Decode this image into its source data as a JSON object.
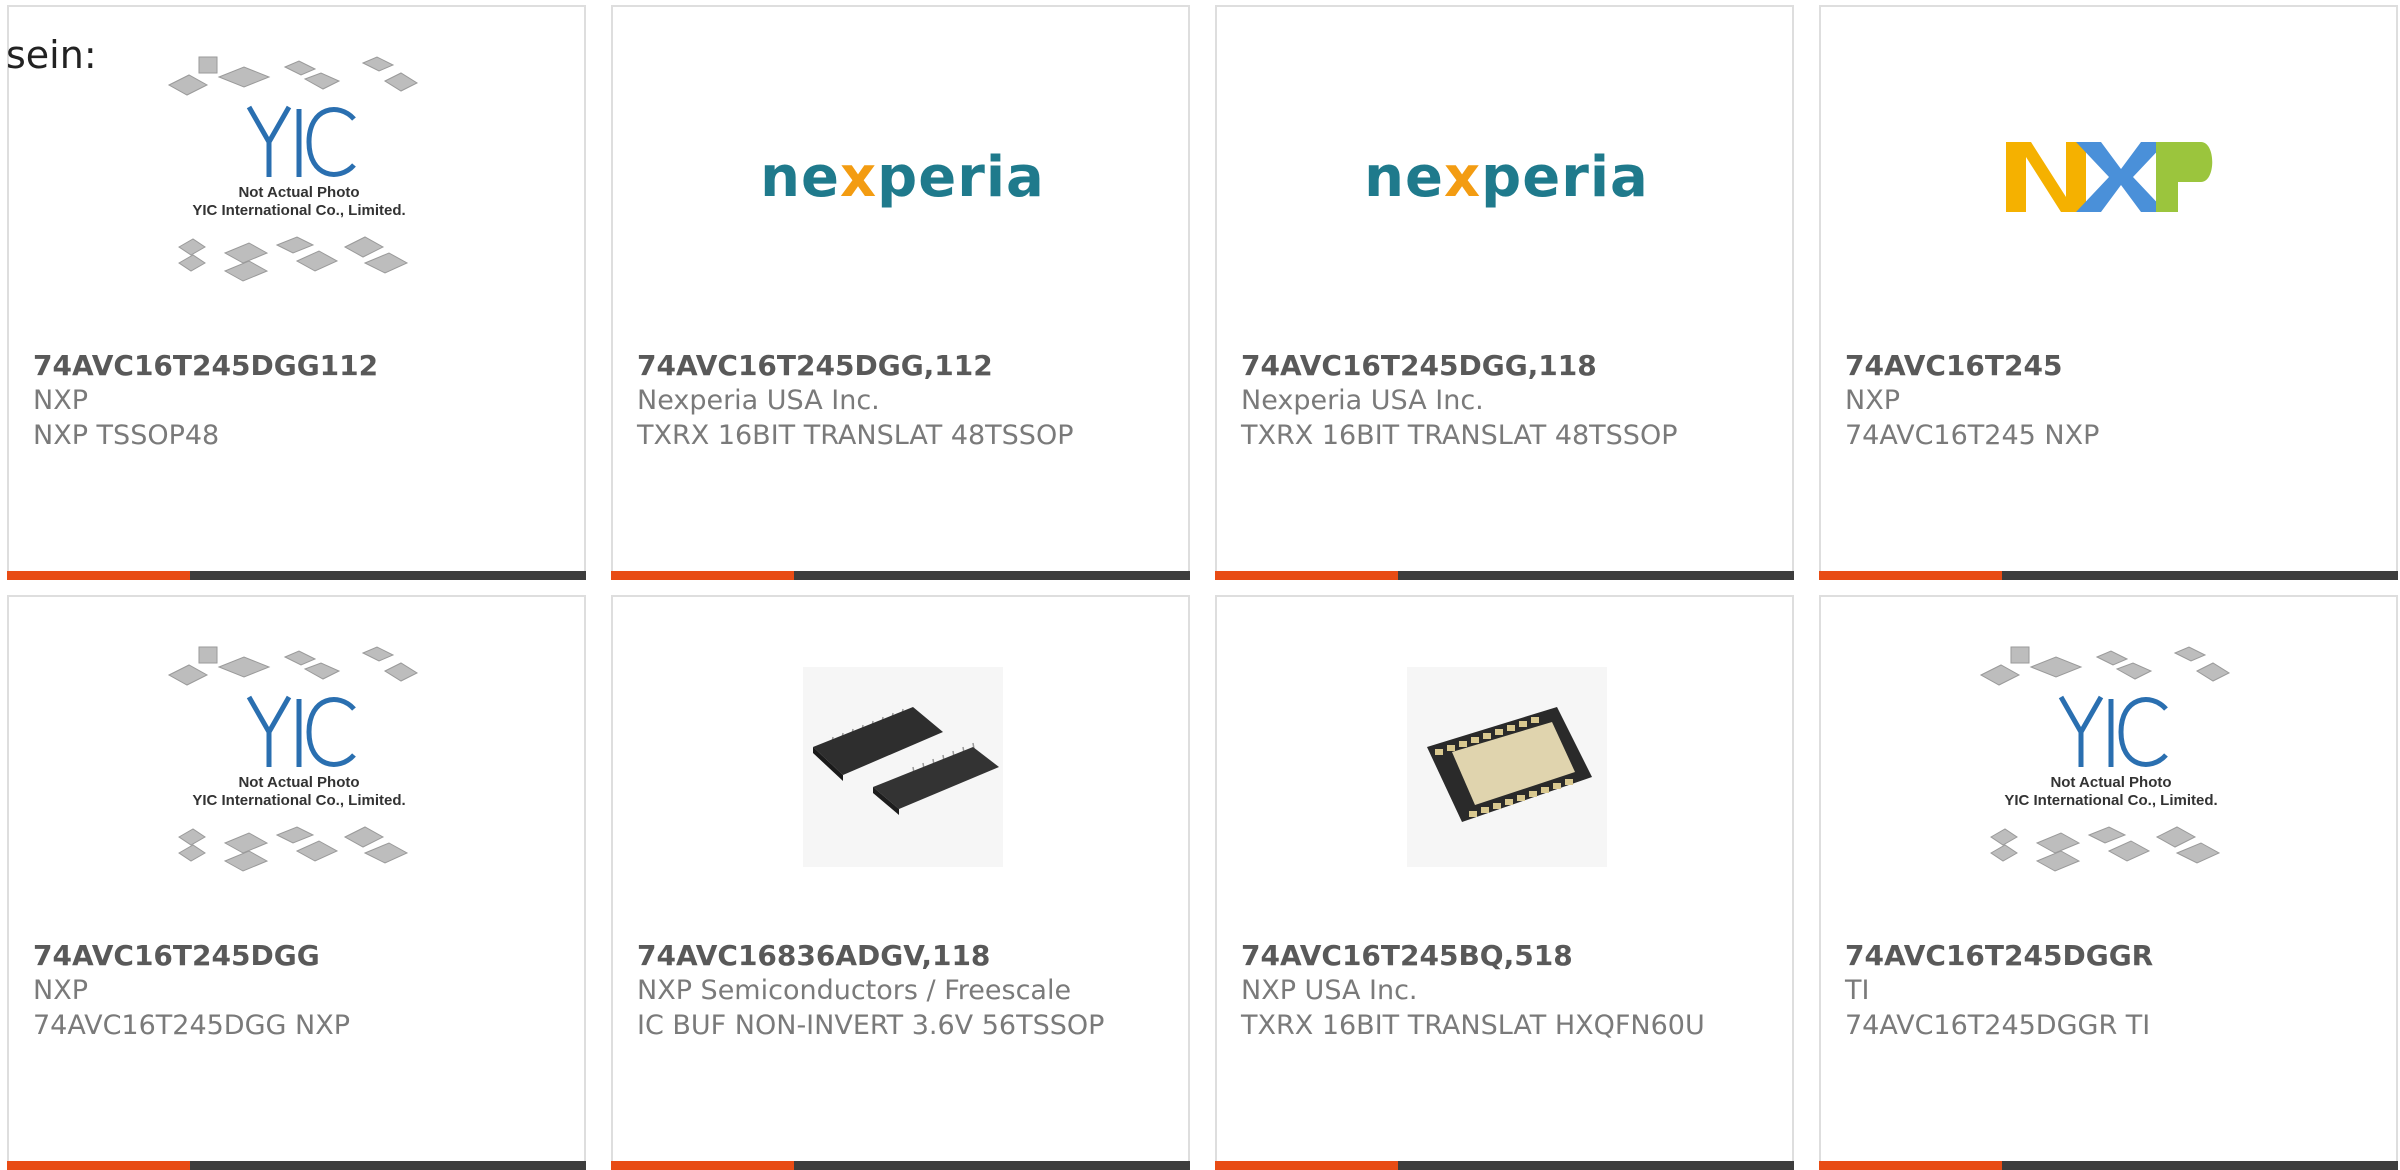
{
  "intro_text": "sein:",
  "brand_colors": {
    "accent": "#e84c15",
    "bar": "#3d3d3d",
    "nexperia_teal": "#1f7a8c",
    "nxp_yellow": "#f5b100",
    "nxp_blue": "#4a90d9",
    "nxp_green": "#9bc53d"
  },
  "products": [
    {
      "name": "74AVC16T245DGG112",
      "brand": "NXP",
      "description": "NXP TSSOP48",
      "image": "yic-placeholder",
      "placeholder": {
        "line1": "Not Actual Photo",
        "line2": "YIC International Co., Limited.",
        "logo": "YIC"
      }
    },
    {
      "name": "74AVC16T245DGG,112",
      "brand": "Nexperia USA Inc.",
      "description": "TXRX 16BIT TRANSLAT 48TSSOP",
      "image": "nexperia-logo",
      "logo_text": {
        "pre": "ne",
        "x": "x",
        "post": "peria"
      }
    },
    {
      "name": "74AVC16T245DGG,118",
      "brand": "Nexperia USA Inc.",
      "description": "TXRX 16BIT TRANSLAT 48TSSOP",
      "image": "nexperia-logo",
      "logo_text": {
        "pre": "ne",
        "x": "x",
        "post": "peria"
      }
    },
    {
      "name": "74AVC16T245",
      "brand": "NXP",
      "description": "74AVC16T245 NXP",
      "image": "nxp-logo",
      "logo_text": "NXP"
    },
    {
      "name": "74AVC16T245DGG",
      "brand": "NXP",
      "description": "74AVC16T245DGG NXP",
      "image": "yic-placeholder",
      "placeholder": {
        "line1": "Not Actual Photo",
        "line2": "YIC International Co., Limited.",
        "logo": "YIC"
      }
    },
    {
      "name": "74AVC16836ADGV,118",
      "brand": "NXP Semiconductors / Freescale",
      "description": "IC BUF NON-INVERT 3.6V 56TSSOP",
      "image": "tssop-chip-photo"
    },
    {
      "name": "74AVC16T245BQ,518",
      "brand": "NXP USA Inc.",
      "description": "TXRX 16BIT TRANSLAT HXQFN60U",
      "image": "qfn-chip-photo"
    },
    {
      "name": "74AVC16T245DGGR",
      "brand": "TI",
      "description": "74AVC16T245DGGR TI",
      "image": "yic-placeholder",
      "placeholder": {
        "line1": "Not Actual Photo",
        "line2": "YIC International Co., Limited.",
        "logo": "YIC"
      }
    }
  ]
}
